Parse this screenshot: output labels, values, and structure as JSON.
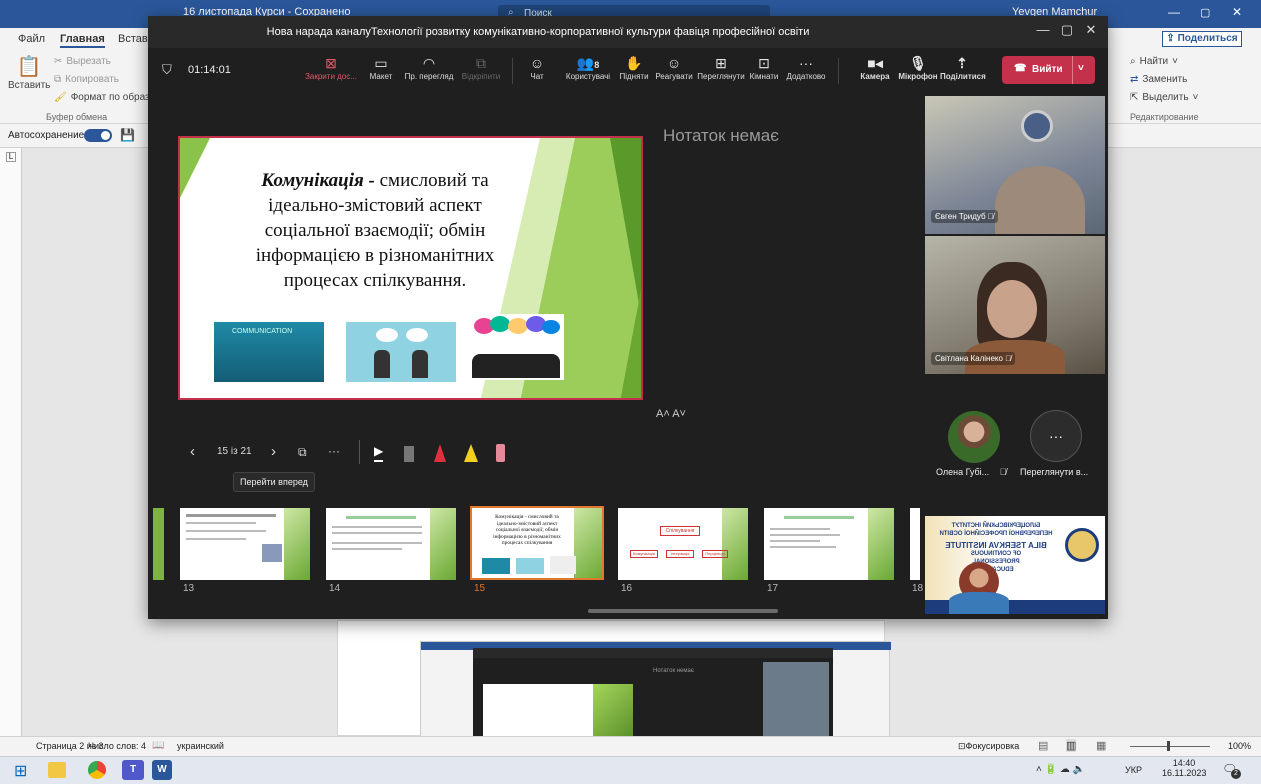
{
  "word": {
    "title": "16 листопада Курси - Сохранено",
    "search_placeholder": "Поиск",
    "user": "Yevgen Mamchur",
    "tabs": [
      "Файл",
      "Главная",
      "Вставк"
    ],
    "share": "Поделиться",
    "clipboard": {
      "paste": "Вставить",
      "cut": "Вырезать",
      "copy": "Копировать",
      "format": "Формат по образцу",
      "group": "Буфер обмена"
    },
    "edit": {
      "find": "Найти",
      "replace": "Заменить",
      "select": "Выделить",
      "group": "Редактирование"
    },
    "autosave": "Автосохранение",
    "status": {
      "page": "Страница 2 из 3",
      "words": "Число слов: 4",
      "lang": "украинский",
      "focus": "Фокусировка",
      "zoom": "100%"
    }
  },
  "taskbar": {
    "lang": "УКР",
    "time": "14:40",
    "date": "16.11.2023",
    "notif": "2"
  },
  "teams": {
    "meeting_title": "Нова нарада каналуТехнології розвитку комунікативно-корпоративної культури фавіця професійної освіти",
    "timer": "01:14:01",
    "toolbar": [
      {
        "label": "Закрити дос...",
        "icon": "close-share-icon"
      },
      {
        "label": "Макет",
        "icon": "layout-icon"
      },
      {
        "label": "Пр. перегляд",
        "icon": "preview-icon"
      },
      {
        "label": "Відкріпити",
        "icon": "unpin-icon"
      },
      {
        "label": "Чат",
        "icon": "chat-icon"
      },
      {
        "label": "Користувачі",
        "icon": "people-icon",
        "count": "8"
      },
      {
        "label": "Підняти",
        "icon": "raise-hand-icon"
      },
      {
        "label": "Реагувати",
        "icon": "react-icon"
      },
      {
        "label": "Переглянути",
        "icon": "view-icon"
      },
      {
        "label": "Кімнати",
        "icon": "rooms-icon"
      },
      {
        "label": "Додатково",
        "icon": "more-icon"
      },
      {
        "label": "Камера",
        "icon": "camera-icon"
      },
      {
        "label": "Мікрофон",
        "icon": "mic-icon"
      },
      {
        "label": "Поділитися",
        "icon": "share-icon"
      }
    ],
    "leave": "Вийти",
    "notes": "Нотаток немає",
    "font_controls": "A˄ A˅",
    "slide": {
      "bold": "Комунікація -",
      "text": " смисловий та ідеально-змістовий аспект соціальної взаємодії; обмін інформацією в різноманітних процесах спілкування.",
      "image1_caption": "COMMUNICATION"
    },
    "nav": {
      "counter": "15 із 21",
      "tooltip": "Перейти вперед"
    },
    "thumbnails": [
      {
        "num": "13",
        "title": ""
      },
      {
        "num": "14",
        "title": ""
      },
      {
        "num": "15",
        "title": "Комунікація - смисловий та ідеально-змістовий аспект соціальної взаємодії; обмін інформацією в різноманітних процесах спілкування"
      },
      {
        "num": "16",
        "title": "Спілкування",
        "boxes": [
          "Комунікація",
          "Інтеракція",
          "Перцепція"
        ]
      },
      {
        "num": "17",
        "title": ""
      },
      {
        "num": "18",
        "title": ""
      }
    ],
    "participants": [
      {
        "name": "Євген Тридуб"
      },
      {
        "name": "Світлана Калінеко"
      },
      {
        "name": "Олена Губі..."
      }
    ],
    "more_view": "Переглянути в...",
    "logo_text": [
      "БІЛОЦЕРКІВСЬКИЙ ІНСТИТУТ",
      "НЕПЕРЕРВНОЇ ПРОФЕСІЙНОЇ ОСВІТИ",
      "BILA TSERKVA INSTITUTE",
      "OF CONTINUOUS",
      "PROFESSIONAL",
      "EDUCATION"
    ]
  },
  "colors": {
    "accent": "#c4314b",
    "teams_bg": "#1f1f1f",
    "word_blue": "#2b579a",
    "slide_green": "#7cb342"
  }
}
